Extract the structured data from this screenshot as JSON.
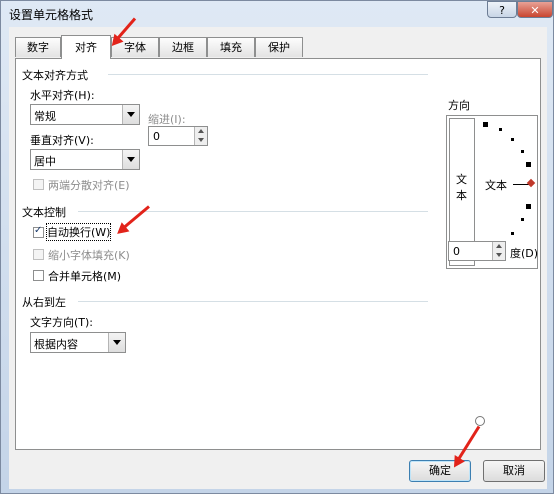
{
  "window": {
    "title": "设置单元格格式",
    "help_label": "?",
    "close_label": "✕"
  },
  "tabs": [
    "数字",
    "对齐",
    "字体",
    "边框",
    "填充",
    "保护"
  ],
  "text_alignment": {
    "section_title": "文本对齐方式",
    "horizontal_label": "水平对齐(H):",
    "horizontal_value": "常规",
    "indent_label": "缩进(I):",
    "indent_value": "0",
    "vertical_label": "垂直对齐(V):",
    "vertical_value": "居中",
    "distributed_label": "两端分散对齐(E)"
  },
  "text_control": {
    "section_title": "文本控制",
    "wrap_label": "自动换行(W)",
    "wrap_checked": true,
    "shrink_label": "缩小字体填充(K)",
    "merge_label": "合并单元格(M)"
  },
  "rtl": {
    "section_title": "从右到左",
    "direction_label": "文字方向(T):",
    "direction_value": "根据内容"
  },
  "orientation": {
    "section_title": "方向",
    "vertical_text": [
      "文",
      "本"
    ],
    "horizontal_text": "文本",
    "degree_value": "0",
    "degree_label": "度(D)"
  },
  "buttons": {
    "ok": "确定",
    "cancel": "取消"
  },
  "colors": {
    "annotation_arrow": "#e2231a",
    "accent_dot": "#c0392b"
  }
}
